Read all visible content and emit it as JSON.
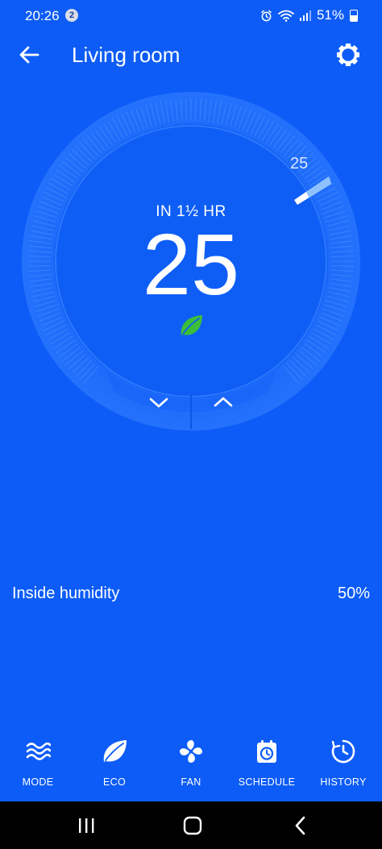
{
  "status_bar": {
    "time": "20:26",
    "notification_count": "2",
    "battery": "51%",
    "icons": [
      "alarm-icon",
      "wifi-icon",
      "signal-icon",
      "battery-icon"
    ]
  },
  "app_bar": {
    "title": "Living room",
    "back_icon": "arrow-left-icon",
    "settings_icon": "gear-icon"
  },
  "thermostat": {
    "subtitle": "IN 1½ HR",
    "current_temperature": "25",
    "target_temperature": "25",
    "eco_icon": "leaf-icon",
    "down_icon": "chevron-down-icon",
    "up_icon": "chevron-up-icon",
    "accent_leaf_color": "#3DBE3A",
    "background_color": "#0D5CF7"
  },
  "humidity": {
    "label": "Inside humidity",
    "value": "50%"
  },
  "bottom_nav": {
    "items": [
      {
        "label": "MODE",
        "icon": "waves-icon"
      },
      {
        "label": "ECO",
        "icon": "leaf-icon"
      },
      {
        "label": "FAN",
        "icon": "fan-icon"
      },
      {
        "label": "SCHEDULE",
        "icon": "calendar-clock-icon"
      },
      {
        "label": "HISTORY",
        "icon": "history-clock-icon"
      }
    ]
  },
  "system_nav": {
    "recents_icon": "recents-icon",
    "home_icon": "home-icon",
    "back_icon": "back-chevron-icon"
  }
}
